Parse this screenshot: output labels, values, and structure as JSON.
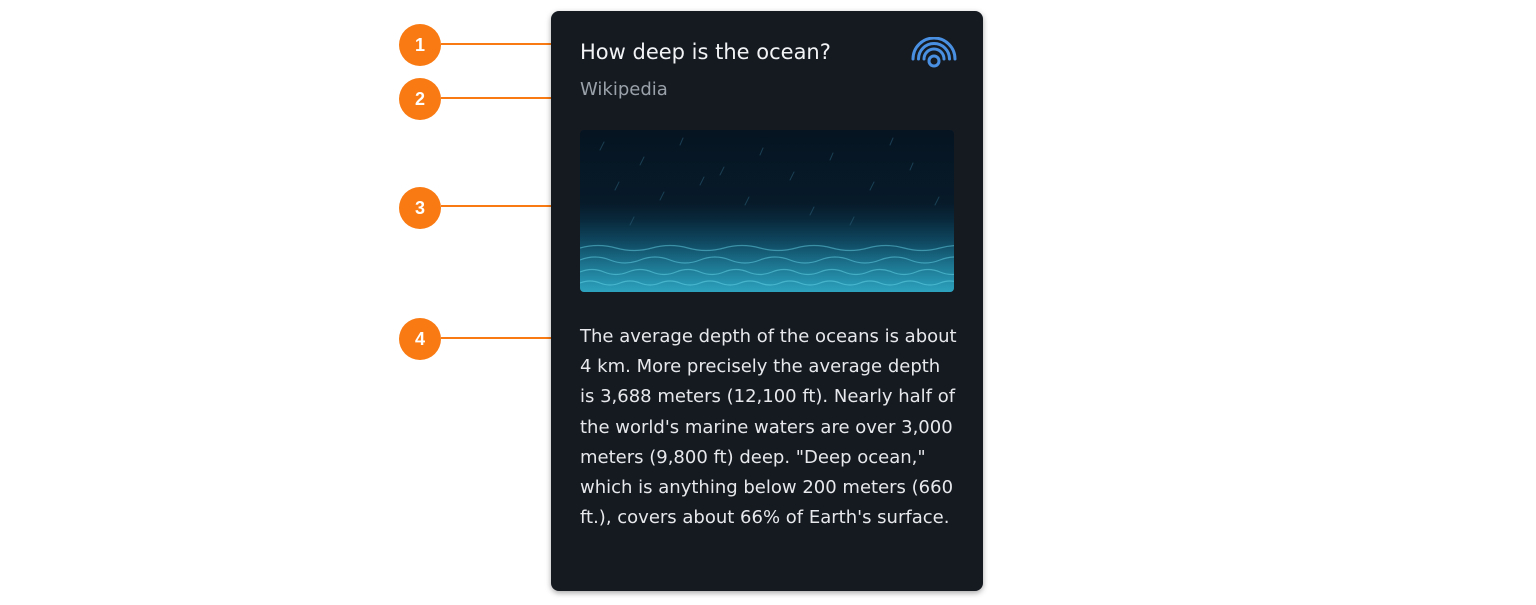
{
  "callouts": [
    "1",
    "2",
    "3",
    "4"
  ],
  "card": {
    "title": "How deep is the ocean?",
    "source": "Wikipedia",
    "icon": "broadcast-signal-icon",
    "image": "ocean-underwater-image",
    "body": "The average depth of the oceans is about 4 km. More precisely the average depth is 3,688 meters (12,100 ft). Nearly half of the world's marine waters are over 3,000 meters (9,800 ft) deep. \"Deep ocean,\" which is anything below 200 meters (660 ft.), covers about 66% of Earth's surface."
  },
  "colors": {
    "callout": "#f97a12",
    "card_background": "#151a21",
    "icon_accent": "#4a90e2"
  }
}
